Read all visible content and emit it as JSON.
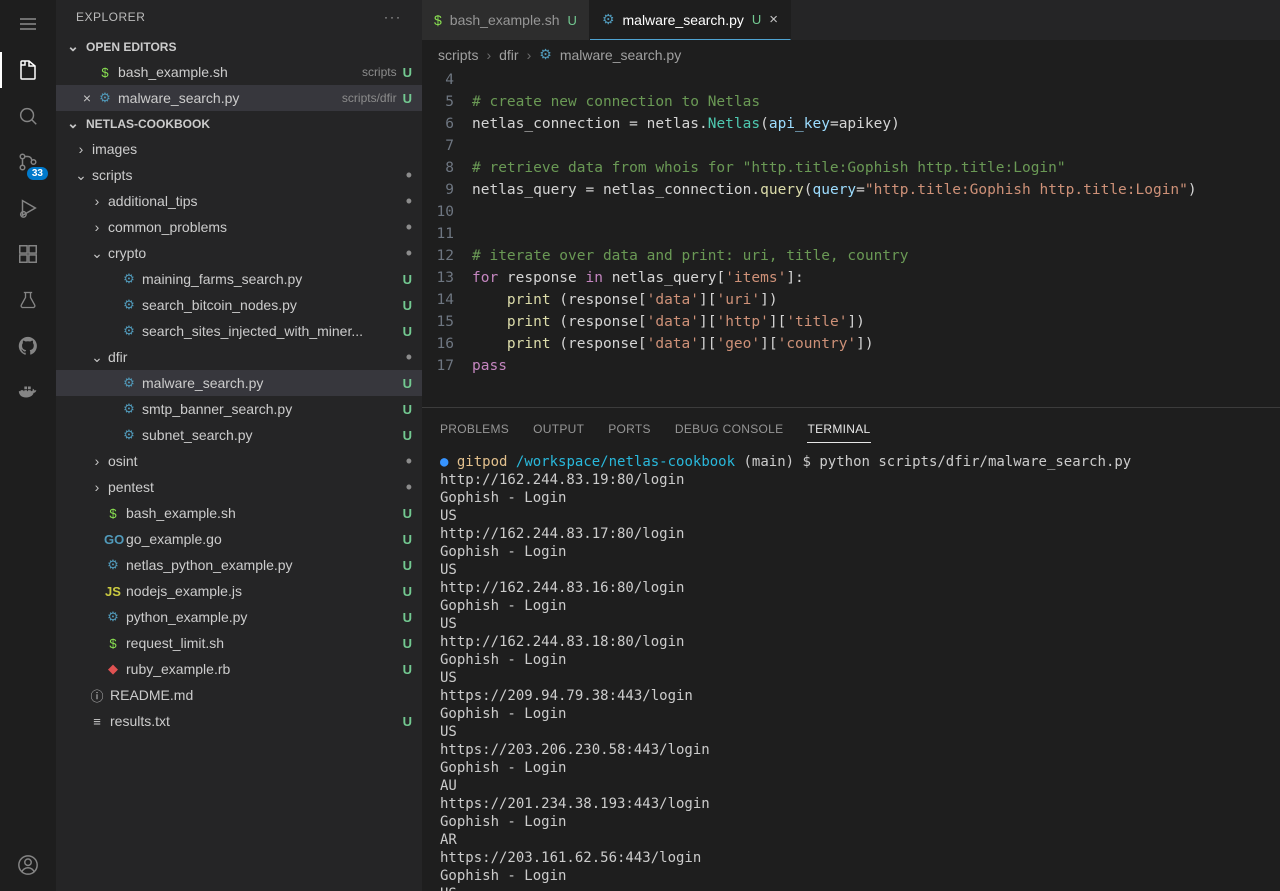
{
  "sidebar": {
    "title": "EXPLORER",
    "openEditors": "OPEN EDITORS",
    "workspace": "NETLAS-COOKBOOK",
    "openFiles": [
      {
        "icon": "$",
        "iconClass": "icon-sh",
        "name": "bash_example.sh",
        "hint": "scripts",
        "status": "U",
        "close": ""
      },
      {
        "icon": "⚙",
        "iconClass": "icon-py",
        "name": "malware_search.py",
        "hint": "scripts/dfir",
        "status": "U",
        "close": "×",
        "selected": true
      }
    ],
    "tree": [
      {
        "depth": 0,
        "chev": "›",
        "icon": "",
        "iconClass": "",
        "name": "images",
        "status": "",
        "dot": false
      },
      {
        "depth": 0,
        "chev": "⌄",
        "icon": "",
        "iconClass": "",
        "name": "scripts",
        "status": "",
        "dot": true
      },
      {
        "depth": 1,
        "chev": "›",
        "icon": "",
        "iconClass": "",
        "name": "additional_tips",
        "status": "",
        "dot": true
      },
      {
        "depth": 1,
        "chev": "›",
        "icon": "",
        "iconClass": "",
        "name": "common_problems",
        "status": "",
        "dot": true
      },
      {
        "depth": 1,
        "chev": "⌄",
        "icon": "",
        "iconClass": "",
        "name": "crypto",
        "status": "",
        "dot": true
      },
      {
        "depth": 2,
        "chev": "",
        "icon": "⚙",
        "iconClass": "icon-py",
        "name": "maining_farms_search.py",
        "status": "U",
        "dot": false
      },
      {
        "depth": 2,
        "chev": "",
        "icon": "⚙",
        "iconClass": "icon-py",
        "name": "search_bitcoin_nodes.py",
        "status": "U",
        "dot": false
      },
      {
        "depth": 2,
        "chev": "",
        "icon": "⚙",
        "iconClass": "icon-py",
        "name": "search_sites_injected_with_miner...",
        "status": "U",
        "dot": false
      },
      {
        "depth": 1,
        "chev": "⌄",
        "icon": "",
        "iconClass": "",
        "name": "dfir",
        "status": "",
        "dot": true
      },
      {
        "depth": 2,
        "chev": "",
        "icon": "⚙",
        "iconClass": "icon-py",
        "name": "malware_search.py",
        "status": "U",
        "dot": false,
        "selected": true
      },
      {
        "depth": 2,
        "chev": "",
        "icon": "⚙",
        "iconClass": "icon-py",
        "name": "smtp_banner_search.py",
        "status": "U",
        "dot": false
      },
      {
        "depth": 2,
        "chev": "",
        "icon": "⚙",
        "iconClass": "icon-py",
        "name": "subnet_search.py",
        "status": "U",
        "dot": false
      },
      {
        "depth": 1,
        "chev": "›",
        "icon": "",
        "iconClass": "",
        "name": "osint",
        "status": "",
        "dot": true
      },
      {
        "depth": 1,
        "chev": "›",
        "icon": "",
        "iconClass": "",
        "name": "pentest",
        "status": "",
        "dot": true
      },
      {
        "depth": 1,
        "chev": "",
        "icon": "$",
        "iconClass": "icon-sh",
        "name": "bash_example.sh",
        "status": "U",
        "dot": false
      },
      {
        "depth": 1,
        "chev": "",
        "icon": "GO",
        "iconClass": "icon-go",
        "name": "go_example.go",
        "status": "U",
        "dot": false
      },
      {
        "depth": 1,
        "chev": "",
        "icon": "⚙",
        "iconClass": "icon-py",
        "name": "netlas_python_example.py",
        "status": "U",
        "dot": false
      },
      {
        "depth": 1,
        "chev": "",
        "icon": "JS",
        "iconClass": "icon-js",
        "name": "nodejs_example.js",
        "status": "U",
        "dot": false
      },
      {
        "depth": 1,
        "chev": "",
        "icon": "⚙",
        "iconClass": "icon-py",
        "name": "python_example.py",
        "status": "U",
        "dot": false
      },
      {
        "depth": 1,
        "chev": "",
        "icon": "$",
        "iconClass": "icon-sh",
        "name": "request_limit.sh",
        "status": "U",
        "dot": false
      },
      {
        "depth": 1,
        "chev": "",
        "icon": "◆",
        "iconClass": "icon-rb",
        "name": "ruby_example.rb",
        "status": "U",
        "dot": false
      },
      {
        "depth": 0,
        "chev": "",
        "icon": "ⓘ",
        "iconClass": "icon-info",
        "name": "README.md",
        "status": "",
        "dot": false
      },
      {
        "depth": 0,
        "chev": "",
        "icon": "≡",
        "iconClass": "icon-txt",
        "name": "results.txt",
        "status": "U",
        "dot": false
      }
    ]
  },
  "sourceControlBadge": "33",
  "tabs": [
    {
      "icon": "$",
      "iconClass": "icon-sh",
      "name": "bash_example.sh",
      "status": "U",
      "active": false,
      "close": false
    },
    {
      "icon": "⚙",
      "iconClass": "icon-py",
      "name": "malware_search.py",
      "status": "U",
      "active": true,
      "close": true
    }
  ],
  "breadcrumb": [
    "scripts",
    "dfir",
    "malware_search.py"
  ],
  "breadcrumbIcon": "⚙",
  "code": {
    "startLine": 4,
    "lines": [
      {
        "n": 4,
        "html": ""
      },
      {
        "n": 5,
        "html": "<span class='c-comment'># create new connection to Netlas</span>"
      },
      {
        "n": 6,
        "html": "netlas_connection <span class='c-punc'>=</span> netlas.<span class='c-type'>Netlas</span>(<span class='c-param'>api_key</span><span class='c-punc'>=</span>apikey)"
      },
      {
        "n": 7,
        "html": ""
      },
      {
        "n": 8,
        "html": "<span class='c-comment'># retrieve data from whois for \"http.title:Gophish http.title:Login\"</span>"
      },
      {
        "n": 9,
        "html": "netlas_query <span class='c-punc'>=</span> netlas_connection.<span class='c-func'>query</span>(<span class='c-param'>query</span><span class='c-punc'>=</span><span class='c-str'>\"http.title:Gophish http.title:Login\"</span>)"
      },
      {
        "n": 10,
        "html": ""
      },
      {
        "n": 11,
        "html": ""
      },
      {
        "n": 12,
        "html": "<span class='c-comment'># iterate over data and print: uri, title, country</span>"
      },
      {
        "n": 13,
        "html": "<span class='c-keyword'>for</span> response <span class='c-keyword'>in</span> netlas_query[<span class='c-str'>'items'</span>]:"
      },
      {
        "n": 14,
        "html": "    <span class='c-func'>print</span> (response[<span class='c-str'>'data'</span>][<span class='c-str'>'uri'</span>])"
      },
      {
        "n": 15,
        "html": "    <span class='c-func'>print</span> (response[<span class='c-str'>'data'</span>][<span class='c-str'>'http'</span>][<span class='c-str'>'title'</span>])"
      },
      {
        "n": 16,
        "html": "    <span class='c-func'>print</span> (response[<span class='c-str'>'data'</span>][<span class='c-str'>'geo'</span>][<span class='c-str'>'country'</span>])"
      },
      {
        "n": 17,
        "html": "<span class='c-keyword'>pass</span>"
      }
    ]
  },
  "panel": {
    "tabs": [
      "PROBLEMS",
      "OUTPUT",
      "PORTS",
      "DEBUG CONSOLE",
      "TERMINAL"
    ],
    "activeTab": 4,
    "prompt": {
      "user": "gitpod",
      "path": "/workspace/netlas-cookbook",
      "branch": "(main)",
      "symbol": "$",
      "cmd": "python scripts/dfir/malware_search.py"
    },
    "output": [
      "http://162.244.83.19:80/login",
      "Gophish - Login",
      "US",
      "http://162.244.83.17:80/login",
      "Gophish - Login",
      "US",
      "http://162.244.83.16:80/login",
      "Gophish - Login",
      "US",
      "http://162.244.83.18:80/login",
      "Gophish - Login",
      "US",
      "https://209.94.79.38:443/login",
      "Gophish - Login",
      "US",
      "https://203.206.230.58:443/login",
      "Gophish - Login",
      "AU",
      "https://201.234.38.193:443/login",
      "Gophish - Login",
      "AR",
      "https://203.161.62.56:443/login",
      "Gophish - Login",
      "US"
    ]
  }
}
